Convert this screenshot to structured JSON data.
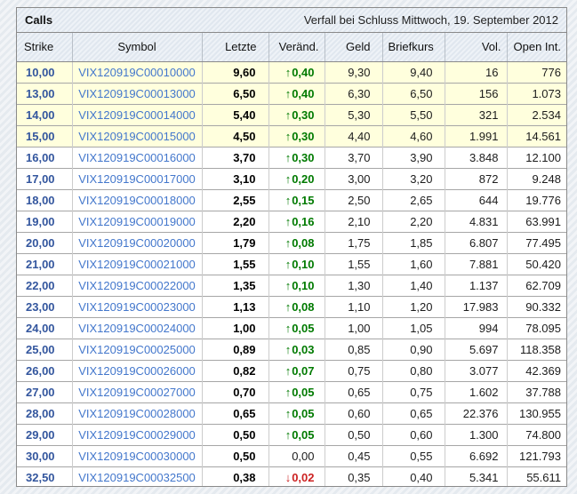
{
  "titlebar": {
    "title": "Calls",
    "expiry": "Verfall bei Schluss Mittwoch, 19. September 2012"
  },
  "columns": [
    "Strike",
    "Symbol",
    "Letzte",
    "Veränd.",
    "Geld",
    "Briefkurs",
    "Vol.",
    "Open Int."
  ],
  "colors": {
    "strike_blue": "#33569e",
    "symbol_blue": "#4377cc",
    "up_green": "#007a00",
    "down_red": "#cc2222",
    "itm_highlight_yellow": "#ffffdd",
    "annotation_red": "#e3181c",
    "header_bg": "#e7edf4"
  },
  "rows": [
    {
      "strike": "10,00",
      "symbol": "VIX120919C00010000",
      "last": "9,60",
      "change": "0,40",
      "change_dir": "up",
      "bid": "9,30",
      "ask": "9,40",
      "vol": "16",
      "oi": "776",
      "highlighted": true,
      "circled": false
    },
    {
      "strike": "13,00",
      "symbol": "VIX120919C00013000",
      "last": "6,50",
      "change": "0,40",
      "change_dir": "up",
      "bid": "6,30",
      "ask": "6,50",
      "vol": "156",
      "oi": "1.073",
      "highlighted": true,
      "circled": false
    },
    {
      "strike": "14,00",
      "symbol": "VIX120919C00014000",
      "last": "5,40",
      "change": "0,30",
      "change_dir": "up",
      "bid": "5,30",
      "ask": "5,50",
      "vol": "321",
      "oi": "2.534",
      "highlighted": true,
      "circled": false
    },
    {
      "strike": "15,00",
      "symbol": "VIX120919C00015000",
      "last": "4,50",
      "change": "0,30",
      "change_dir": "up",
      "bid": "4,40",
      "ask": "4,60",
      "vol": "1.991",
      "oi": "14.561",
      "highlighted": true,
      "circled": false
    },
    {
      "strike": "16,00",
      "symbol": "VIX120919C00016000",
      "last": "3,70",
      "change": "0,30",
      "change_dir": "up",
      "bid": "3,70",
      "ask": "3,90",
      "vol": "3.848",
      "oi": "12.100",
      "highlighted": false,
      "circled": false
    },
    {
      "strike": "17,00",
      "symbol": "VIX120919C00017000",
      "last": "3,10",
      "change": "0,20",
      "change_dir": "up",
      "bid": "3,00",
      "ask": "3,20",
      "vol": "872",
      "oi": "9.248",
      "highlighted": false,
      "circled": true
    },
    {
      "strike": "18,00",
      "symbol": "VIX120919C00018000",
      "last": "2,55",
      "change": "0,15",
      "change_dir": "up",
      "bid": "2,50",
      "ask": "2,65",
      "vol": "644",
      "oi": "19.776",
      "highlighted": false,
      "circled": false
    },
    {
      "strike": "19,00",
      "symbol": "VIX120919C00019000",
      "last": "2,20",
      "change": "0,16",
      "change_dir": "up",
      "bid": "2,10",
      "ask": "2,20",
      "vol": "4.831",
      "oi": "63.991",
      "highlighted": false,
      "circled": false
    },
    {
      "strike": "20,00",
      "symbol": "VIX120919C00020000",
      "last": "1,79",
      "change": "0,08",
      "change_dir": "up",
      "bid": "1,75",
      "ask": "1,85",
      "vol": "6.807",
      "oi": "77.495",
      "highlighted": false,
      "circled": true
    },
    {
      "strike": "21,00",
      "symbol": "VIX120919C00021000",
      "last": "1,55",
      "change": "0,10",
      "change_dir": "up",
      "bid": "1,55",
      "ask": "1,60",
      "vol": "7.881",
      "oi": "50.420",
      "highlighted": false,
      "circled": false
    },
    {
      "strike": "22,00",
      "symbol": "VIX120919C00022000",
      "last": "1,35",
      "change": "0,10",
      "change_dir": "up",
      "bid": "1,30",
      "ask": "1,40",
      "vol": "1.137",
      "oi": "62.709",
      "highlighted": false,
      "circled": false
    },
    {
      "strike": "23,00",
      "symbol": "VIX120919C00023000",
      "last": "1,13",
      "change": "0,08",
      "change_dir": "up",
      "bid": "1,10",
      "ask": "1,20",
      "vol": "17.983",
      "oi": "90.332",
      "highlighted": false,
      "circled": false
    },
    {
      "strike": "24,00",
      "symbol": "VIX120919C00024000",
      "last": "1,00",
      "change": "0,05",
      "change_dir": "up",
      "bid": "1,00",
      "ask": "1,05",
      "vol": "994",
      "oi": "78.095",
      "highlighted": false,
      "circled": false
    },
    {
      "strike": "25,00",
      "symbol": "VIX120919C00025000",
      "last": "0,89",
      "change": "0,03",
      "change_dir": "up",
      "bid": "0,85",
      "ask": "0,90",
      "vol": "5.697",
      "oi": "118.358",
      "highlighted": false,
      "circled": false
    },
    {
      "strike": "26,00",
      "symbol": "VIX120919C00026000",
      "last": "0,82",
      "change": "0,07",
      "change_dir": "up",
      "bid": "0,75",
      "ask": "0,80",
      "vol": "3.077",
      "oi": "42.369",
      "highlighted": false,
      "circled": false
    },
    {
      "strike": "27,00",
      "symbol": "VIX120919C00027000",
      "last": "0,70",
      "change": "0,05",
      "change_dir": "up",
      "bid": "0,65",
      "ask": "0,75",
      "vol": "1.602",
      "oi": "37.788",
      "highlighted": false,
      "circled": false
    },
    {
      "strike": "28,00",
      "symbol": "VIX120919C00028000",
      "last": "0,65",
      "change": "0,05",
      "change_dir": "up",
      "bid": "0,60",
      "ask": "0,65",
      "vol": "22.376",
      "oi": "130.955",
      "highlighted": false,
      "circled": false
    },
    {
      "strike": "29,00",
      "symbol": "VIX120919C00029000",
      "last": "0,50",
      "change": "0,05",
      "change_dir": "up",
      "bid": "0,50",
      "ask": "0,60",
      "vol": "1.300",
      "oi": "74.800",
      "highlighted": false,
      "circled": false
    },
    {
      "strike": "30,00",
      "symbol": "VIX120919C00030000",
      "last": "0,50",
      "change": "0,00",
      "change_dir": "none",
      "bid": "0,45",
      "ask": "0,55",
      "vol": "6.692",
      "oi": "121.793",
      "highlighted": false,
      "circled": false
    },
    {
      "strike": "32,50",
      "symbol": "VIX120919C00032500",
      "last": "0,38",
      "change": "0,02",
      "change_dir": "down",
      "bid": "0,35",
      "ask": "0,40",
      "vol": "5.341",
      "oi": "55.611",
      "highlighted": false,
      "circled": false
    }
  ]
}
